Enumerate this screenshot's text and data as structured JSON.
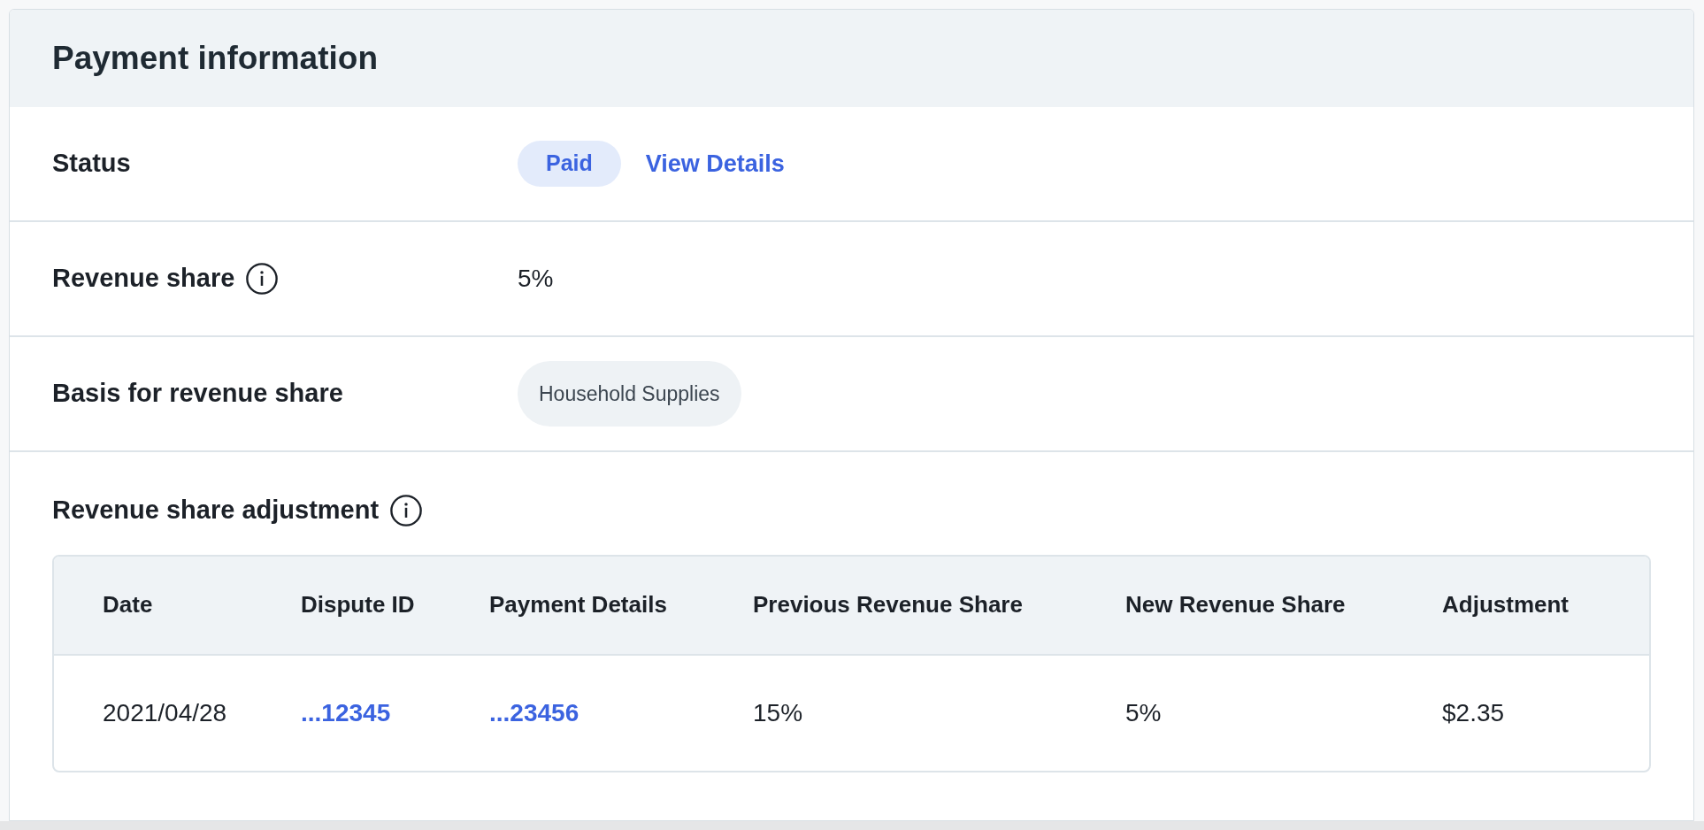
{
  "card": {
    "title": "Payment information"
  },
  "rows": [
    {
      "kind": "status",
      "label": "Status",
      "info": false,
      "badge": "Paid",
      "link": "View Details"
    },
    {
      "kind": "text",
      "label": "Revenue share",
      "info": true,
      "value": "5%"
    },
    {
      "kind": "chip",
      "label": "Basis for revenue share",
      "info": false,
      "chip": "Household Supplies"
    }
  ],
  "adjustment": {
    "title": "Revenue share adjustment",
    "info": true,
    "table": {
      "columns": [
        "Date",
        "Dispute ID",
        "Payment Details",
        "Previous Revenue Share",
        "New Revenue Share",
        "Adjustment"
      ],
      "rows": [
        [
          {
            "kind": "text",
            "text": "2021/04/28"
          },
          {
            "kind": "link",
            "text": "...12345"
          },
          {
            "kind": "link",
            "text": "...23456"
          },
          {
            "kind": "text",
            "text": "15%"
          },
          {
            "kind": "text",
            "text": "5%"
          },
          {
            "kind": "text",
            "text": "$2.35"
          }
        ]
      ]
    }
  }
}
